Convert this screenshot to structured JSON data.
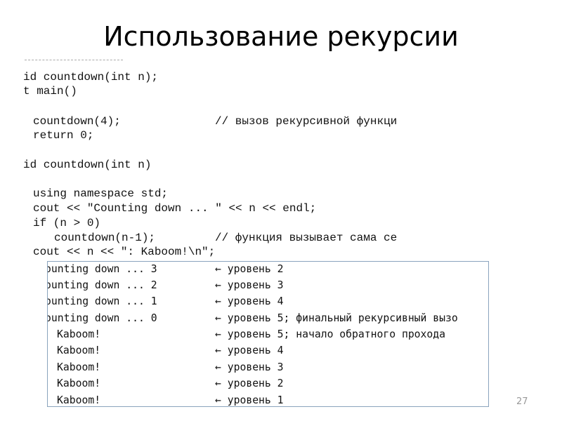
{
  "title": "Использование рекурсии",
  "code": [
    {
      "text": "id countdown(int n);",
      "comment": ""
    },
    {
      "text": "t main()",
      "comment": ""
    },
    {
      "text": "countdown(4);",
      "comment": "// вызов рекурсивной функци"
    },
    {
      "text": "return 0;",
      "comment": ""
    },
    {
      "text": "id countdown(int n)",
      "comment": ""
    },
    {
      "text": "using namespace std;",
      "comment": ""
    },
    {
      "text": "cout << \"Counting down ... \" << n << endl;",
      "comment": ""
    },
    {
      "text": "if (n > 0)",
      "comment": ""
    },
    {
      "text": "countdown(n-1);",
      "comment": "// функция вызывает сама се"
    },
    {
      "text": "cout << n << \": Kaboom!\\n\";",
      "comment": ""
    }
  ],
  "output": [
    {
      "text": "ounting down ... 3",
      "note": "← уровень 2"
    },
    {
      "text": "ounting down ... 2",
      "note": "← уровень 3"
    },
    {
      "text": "ounting down ... 1",
      "note": "← уровень 4"
    },
    {
      "text": "ounting down ... 0",
      "note": "← уровень 5; финальный рекурсивный вызо"
    },
    {
      "text": "Kaboom!",
      "note": "← уровень 5; начало обратного прохода"
    },
    {
      "text": "Kaboom!",
      "note": "← уровень 4"
    },
    {
      "text": "Kaboom!",
      "note": "← уровень 3"
    },
    {
      "text": "Kaboom!",
      "note": "← уровень 2"
    },
    {
      "text": "Kaboom!",
      "note": "← уровень 1"
    }
  ],
  "page_number": "27"
}
